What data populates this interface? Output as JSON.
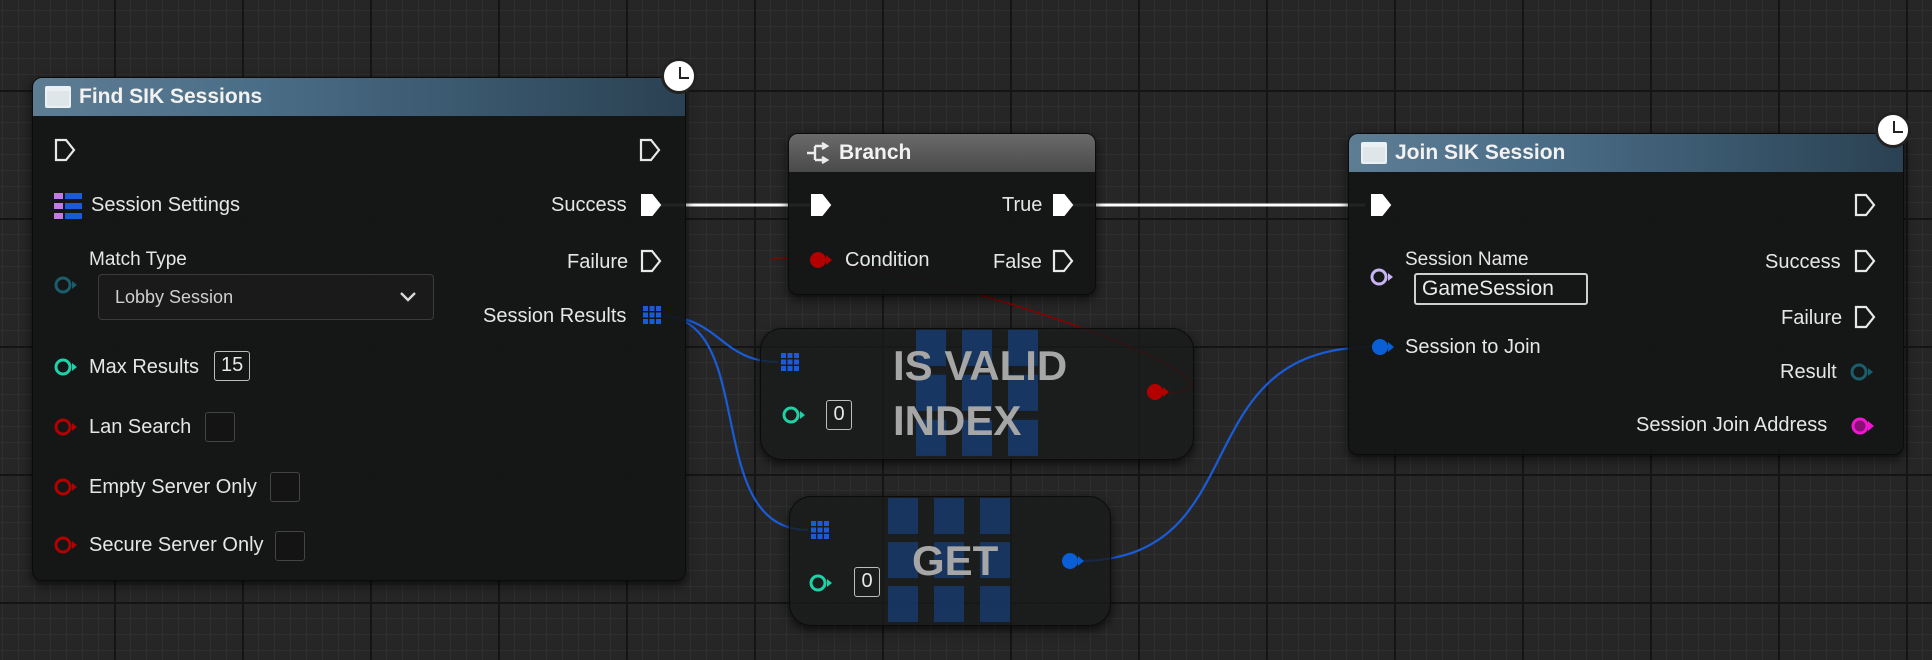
{
  "nodes": {
    "find": {
      "title": "Find SIK Sessions",
      "session_settings": "Session Settings",
      "match_type": "Match Type",
      "match_type_value": "Lobby Session",
      "max_results": "Max Results",
      "max_results_value": "15",
      "lan_search": "Lan Search",
      "empty_server_only": "Empty Server Only",
      "secure_server_only": "Secure Server Only",
      "success": "Success",
      "failure": "Failure",
      "session_results": "Session Results"
    },
    "branch": {
      "title": "Branch",
      "condition": "Condition",
      "true_label": "True",
      "false_label": "False"
    },
    "is_valid": {
      "title_line1": "IS VALID",
      "title_line2": "INDEX",
      "index_value": "0"
    },
    "get": {
      "title": "GET",
      "index_value": "0"
    },
    "join": {
      "title": "Join SIK Session",
      "session_name": "Session Name",
      "session_name_value": "GameSession",
      "session_to_join": "Session to Join",
      "success": "Success",
      "failure": "Failure",
      "result": "Result",
      "session_join_address": "Session Join Address"
    }
  },
  "icons": {
    "function": "function-icon",
    "branch": "branch-icon",
    "latent": "clock-icon",
    "array": "array-grid-icon",
    "struct": "struct-icon",
    "chevron": "chevron-down-icon"
  },
  "colors": {
    "exec": "#ffffff",
    "integer": "#1fd1a6",
    "boolean": "#b30000",
    "struct_blue": "#0a5fd6",
    "enum": "#1a5d6d",
    "name": "#c7b3f5",
    "string": "#f017d1",
    "bool_wire": "#8a0000",
    "struct_wire": "#0a5fd6"
  }
}
